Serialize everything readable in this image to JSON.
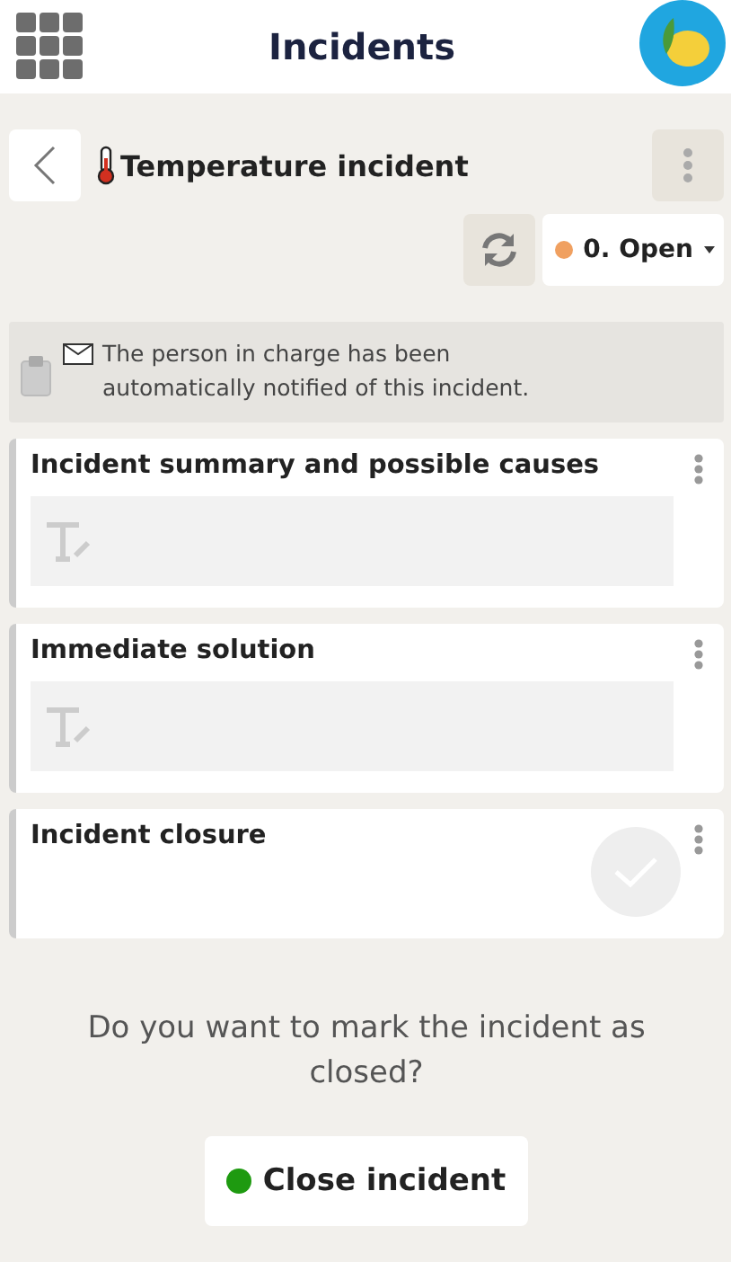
{
  "header": {
    "title": "Incidents"
  },
  "incident": {
    "title": "Temperature incident",
    "status": {
      "label": "0. Open",
      "color": "#f0a060"
    }
  },
  "notice": {
    "text": "The person in charge has been automatically notified of this incident."
  },
  "sections": [
    {
      "kind": "text",
      "title": "Incident summary and possible causes"
    },
    {
      "kind": "text",
      "title": "Immediate solution"
    },
    {
      "kind": "check",
      "title": "Incident closure",
      "checked": false
    }
  ],
  "prompt": "Do you want to mark the incident as closed?",
  "action": {
    "label": "Close incident",
    "color": "#1e9a10"
  }
}
